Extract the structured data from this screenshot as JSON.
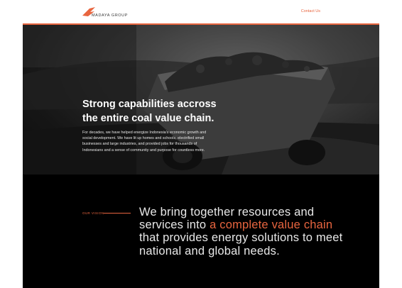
{
  "brand": {
    "name": "MADAYA GROUP",
    "accent_color": "#e8653f"
  },
  "nav": {
    "contact_label": "Contact Us"
  },
  "hero": {
    "title_line1": "Strong capabilities accross",
    "title_line2": "the entire coal value chain.",
    "body": "For decades, we have helped energize Indonesia's economic growth and social development. We have lit up homes and schools, electrified small businesses and large industries, and provided jobs for thousands of Indonesians and a sense of community and purpose for countless more."
  },
  "vision": {
    "label": "OUR VISION",
    "text_before": "We bring together resources and services into ",
    "text_accent": "a complete value chain",
    "text_after": " that provides energy solutions to meet national and global needs."
  }
}
